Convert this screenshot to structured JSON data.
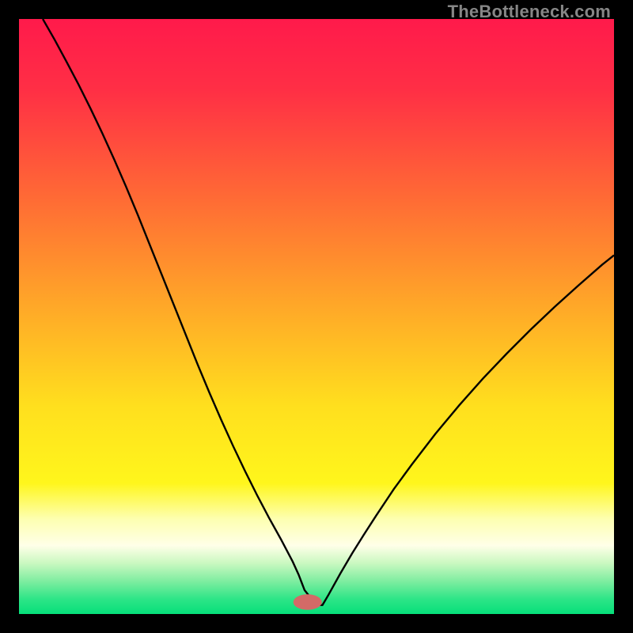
{
  "watermark": "TheBottleneck.com",
  "chart_data": {
    "type": "line",
    "title": "",
    "xlabel": "",
    "ylabel": "",
    "xlim": [
      0,
      100
    ],
    "ylim": [
      0,
      100
    ],
    "grid": false,
    "legend": false,
    "background_gradient": {
      "stops": [
        {
          "offset": 0.0,
          "color": "#ff1a4b"
        },
        {
          "offset": 0.12,
          "color": "#ff2f45"
        },
        {
          "offset": 0.3,
          "color": "#ff6a35"
        },
        {
          "offset": 0.48,
          "color": "#ffa728"
        },
        {
          "offset": 0.65,
          "color": "#ffdf1e"
        },
        {
          "offset": 0.78,
          "color": "#fff61c"
        },
        {
          "offset": 0.84,
          "color": "#fdffb0"
        },
        {
          "offset": 0.885,
          "color": "#ffffe8"
        },
        {
          "offset": 0.915,
          "color": "#c9f8c0"
        },
        {
          "offset": 0.945,
          "color": "#7eeda0"
        },
        {
          "offset": 0.975,
          "color": "#2de587"
        },
        {
          "offset": 1.0,
          "color": "#06df7a"
        }
      ]
    },
    "marker": {
      "x": 48.5,
      "y": 2.0,
      "rx": 2.4,
      "ry": 1.3,
      "color": "#d36a67"
    },
    "series": [
      {
        "name": "bottleneck-curve",
        "color": "#000000",
        "stroke_width": 2.4,
        "x": [
          4.0,
          6,
          8,
          10,
          12,
          14,
          16,
          18,
          20,
          22,
          24,
          26,
          28,
          30,
          32,
          34,
          36,
          38,
          40,
          42,
          44,
          46,
          47,
          48,
          50,
          51,
          52,
          54,
          56,
          58,
          60,
          63,
          66,
          70,
          74,
          78,
          82,
          86,
          90,
          94,
          98,
          100
        ],
        "values": [
          100,
          96.5,
          92.8,
          89,
          85,
          80.8,
          76.4,
          71.8,
          67,
          62,
          57,
          52,
          47,
          42,
          37.2,
          32.6,
          28.2,
          24,
          20,
          16.2,
          12.6,
          8.8,
          6.6,
          4,
          1.5,
          1.5,
          3.2,
          6.8,
          10.2,
          13.4,
          16.5,
          21,
          25.1,
          30.3,
          35.1,
          39.6,
          43.8,
          47.8,
          51.6,
          55.2,
          58.7,
          60.3
        ]
      }
    ]
  }
}
